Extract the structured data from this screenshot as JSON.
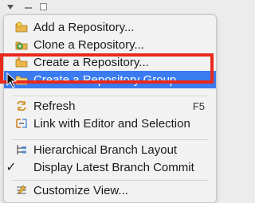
{
  "window_controls": {
    "menu_icon": "triangle-down-icon",
    "minimize_icon": "minimize-icon",
    "maximize_icon": "maximize-icon"
  },
  "menu": {
    "items": [
      {
        "label": "Add a Repository...",
        "icon": "add-repository-icon",
        "shortcut": "",
        "checked": false
      },
      {
        "label": "Clone a Repository...",
        "icon": "clone-repository-icon",
        "shortcut": "",
        "checked": false
      },
      {
        "label": "Create a Repository...",
        "icon": "create-repository-icon",
        "shortcut": "",
        "checked": false
      },
      {
        "label": "Create a Repository Group...",
        "icon": "folder-icon",
        "shortcut": "",
        "checked": false,
        "highlighted": true
      },
      {
        "label": "Refresh",
        "icon": "refresh-icon",
        "shortcut": "F5",
        "checked": false
      },
      {
        "label": "Link with Editor and Selection",
        "icon": "link-icon",
        "shortcut": "",
        "checked": false
      },
      {
        "label": "Hierarchical Branch Layout",
        "icon": "hierarchy-icon",
        "shortcut": "",
        "checked": false
      },
      {
        "label": "Display Latest Branch Commit",
        "icon": "",
        "shortcut": "",
        "checked": true
      },
      {
        "label": "Customize View...",
        "icon": "customize-icon",
        "shortcut": "",
        "checked": false
      }
    ],
    "check_glyph": "✓"
  },
  "colors": {
    "highlight": "#3a7bf0",
    "annotation_frame": "#e8291c",
    "menu_bg": "#f2f2f2"
  }
}
